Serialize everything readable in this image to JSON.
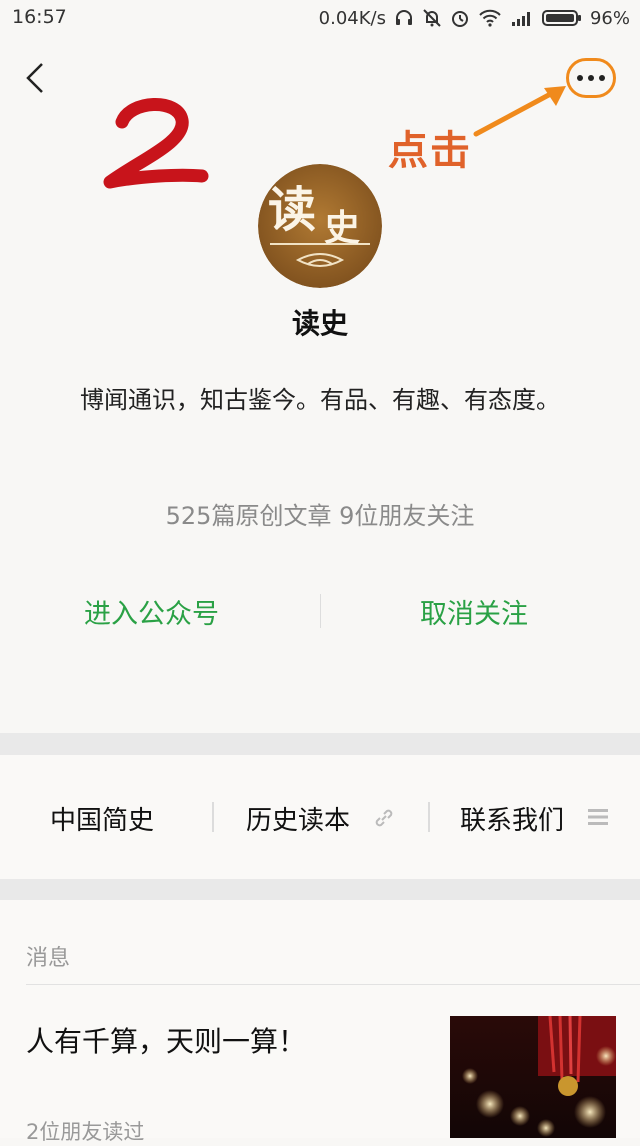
{
  "status_bar": {
    "time": "16:57",
    "speed": "0.04K/s",
    "battery": "96%",
    "icons": [
      "headphones-icon",
      "alarm-off-icon",
      "alarm-icon",
      "wifi-icon",
      "signal-icon",
      "battery-icon"
    ]
  },
  "header": {
    "back_icon": "chevron-left-icon",
    "more_icon": "more-dots-icon"
  },
  "annotation": {
    "step_number": "2",
    "hint": "点击",
    "color": "#f08a1c"
  },
  "profile": {
    "avatar_text_1": "读",
    "avatar_text_2": "史",
    "name": "读史",
    "description": "博闻通识，知古鉴今。有品、有趣、有态度。",
    "stats": "525篇原创文章  9位朋友关注"
  },
  "actions": {
    "enter": "进入公众号",
    "unfollow": "取消关注",
    "accent": "#2aa145"
  },
  "menu": {
    "items": [
      {
        "label": "中国简史",
        "icon": ""
      },
      {
        "label": "历史读本",
        "icon": "link-icon"
      },
      {
        "label": "联系我们",
        "icon": "menu-lines-icon"
      }
    ]
  },
  "feed": {
    "section_label": "消息",
    "articles": [
      {
        "title": "人有千算，天则一算！",
        "meta": "2位朋友读过"
      }
    ]
  }
}
